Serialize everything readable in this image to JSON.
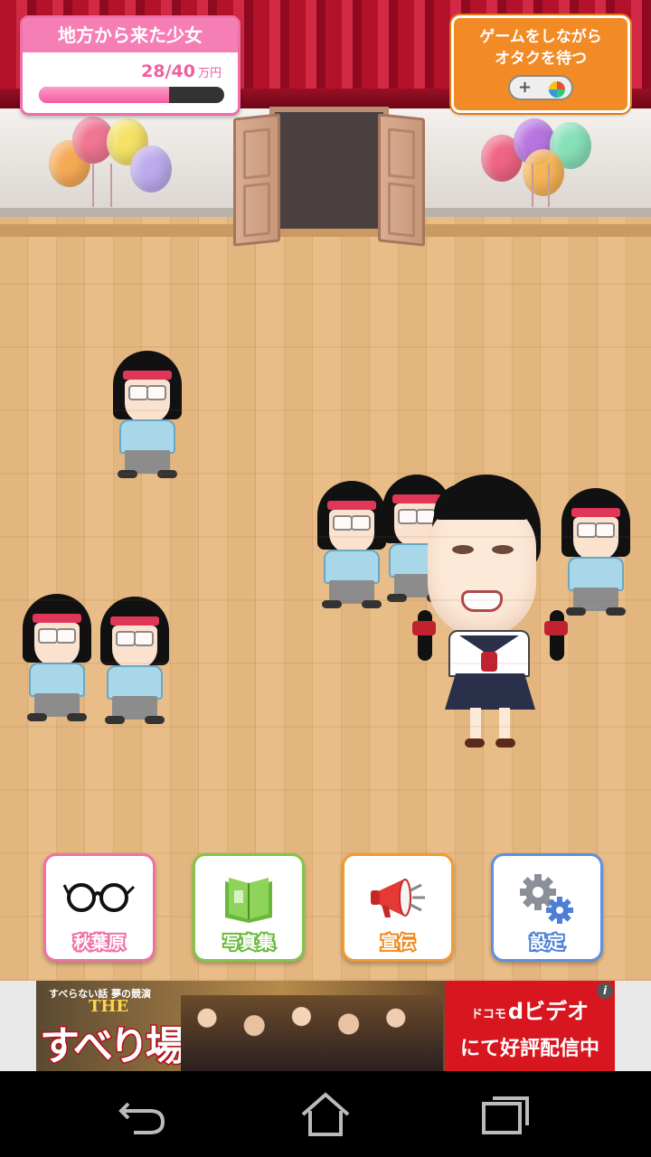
{
  "hud": {
    "stage_title": "地方から来た少女",
    "fans_current": 28,
    "fans_goal": 40,
    "count_text": "28/40",
    "unit": "万円",
    "progress_fraction": 0.7
  },
  "wait_button": {
    "line1": "ゲームをしながら",
    "line2": "オタクを待つ",
    "icon": "gamepad-icon"
  },
  "menu": {
    "akihabara": {
      "label": "秋葉原",
      "icon": "glasses-icon",
      "color": "#f070a8"
    },
    "photobook": {
      "label": "写真集",
      "icon": "book-icon",
      "color": "#7dc84a"
    },
    "promotion": {
      "label": "宣伝",
      "icon": "megaphone-icon",
      "color": "#f39a2e"
    },
    "settings": {
      "label": "設定",
      "icon": "gears-icon",
      "color": "#5e8fe0"
    }
  },
  "ad": {
    "tagline": "すべらない話 夢の競演",
    "the": "THE",
    "title": "すべり場",
    "brand": "ドコモ",
    "service": "dビデオ",
    "cta": "にて好評配信中",
    "info_icon": "i"
  },
  "navbar": {
    "back": "back-icon",
    "home": "home-icon",
    "recents": "recents-icon"
  }
}
